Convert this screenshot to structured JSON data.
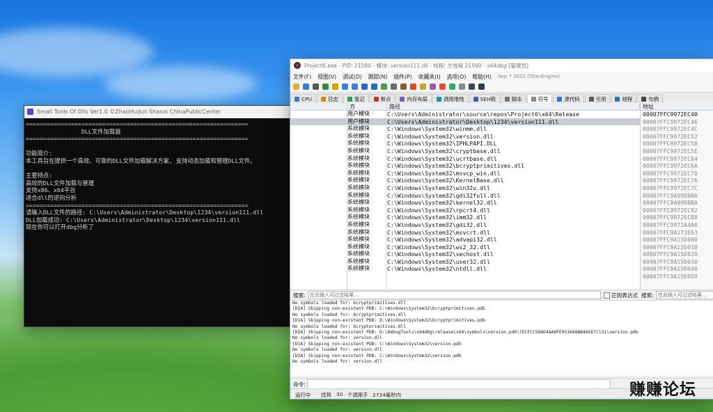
{
  "console": {
    "title": "Small Tools Of Dlls Ver1.0 ©ZhaoHuiJun Shanxi ChinaPublicCenter",
    "lines": [
      "================================================================",
      "                DLL文件加载器",
      "================================================================",
      "",
      "功能简介:",
      "本工具旨在提供一个高效、可靠的DLL文件加载解决方案, 支持动态加载和管理DLL文件。",
      "",
      "主要特点:",
      "高效的DLL文件加载与管理",
      "支持x86、x64平台",
      "适合dll的逆向分析",
      "================================================================",
      "请输入DLL文件的路径: C:\\Users\\Administrator\\Desktop\\1234\\version111.dll",
      "DLL加载成功: C:\\Users\\Administrator\\Desktop\\1234\\version111.dll",
      "现在你可以打开dbg分析了"
    ]
  },
  "dbg": {
    "title": "Project6.exe - PID: 21580 - 模块: version111.dll - 线程: 主线程 21560 - x64dbg [管理员]",
    "menu": [
      "文件(F)",
      "视图(V)",
      "调试(D)",
      "跟踪(N)",
      "插件(P)",
      "收藏夹(I)",
      "选项(O)",
      "帮助(H)"
    ],
    "menu_date": "Sep 7 2022 (TitanEngine)",
    "tabs": [
      "CPU",
      "日志",
      "笔记",
      "断点",
      "内存布局",
      "调用堆栈",
      "SEH链",
      "脚本",
      "符号",
      "源代码",
      "引用",
      "线程",
      "句柄"
    ],
    "active_tab": "符号",
    "headers": {
      "type": "方",
      "path": "路径",
      "addr": "地址"
    },
    "modules": [
      {
        "type": "用户模块",
        "path": "C:\\Users\\Administrator\\source\\repos\\Project6\\x64\\Release"
      },
      {
        "type": "用户模块",
        "path": "C:\\Users\\Administrator\\Desktop\\1234\\version111.dll"
      },
      {
        "type": "系统模块",
        "path": "C:\\Windows\\System32\\winmm.dll"
      },
      {
        "type": "系统模块",
        "path": "C:\\Windows\\System32\\version.dll"
      },
      {
        "type": "系统模块",
        "path": "C:\\Windows\\System32\\IPHLPAPI.DLL"
      },
      {
        "type": "系统模块",
        "path": "C:\\Windows\\System32\\cryptbase.dll"
      },
      {
        "type": "系统模块",
        "path": "C:\\Windows\\System32\\ucrtbase.dll"
      },
      {
        "type": "系统模块",
        "path": "C:\\Windows\\System32\\bcryptprimitives.dll"
      },
      {
        "type": "系统模块",
        "path": "C:\\Windows\\System32\\msvcp_win.dll"
      },
      {
        "type": "系统模块",
        "path": "C:\\Windows\\System32\\KernelBase.dll"
      },
      {
        "type": "系统模块",
        "path": "C:\\Windows\\System32\\win32u.dll"
      },
      {
        "type": "系统模块",
        "path": "C:\\Windows\\System32\\gdi32full.dll"
      },
      {
        "type": "系统模块",
        "path": "C:\\Windows\\System32\\kernel32.dll"
      },
      {
        "type": "系统模块",
        "path": "C:\\Windows\\System32\\rpcrt4.dll"
      },
      {
        "type": "系统模块",
        "path": "C:\\Windows\\System32\\imm32.dll"
      },
      {
        "type": "系统模块",
        "path": "C:\\Windows\\System32\\gdi32.dll"
      },
      {
        "type": "系统模块",
        "path": "C:\\Windows\\System32\\msvcrt.dll"
      },
      {
        "type": "系统模块",
        "path": "C:\\Windows\\System32\\advapi32.dll"
      },
      {
        "type": "系统模块",
        "path": "C:\\Windows\\System32\\ws2_32.dll"
      },
      {
        "type": "系统模块",
        "path": "C:\\Windows\\System32\\sechost.dll"
      },
      {
        "type": "系统模块",
        "path": "C:\\Windows\\System32\\user32.dll"
      },
      {
        "type": "系统模块",
        "path": "C:\\Windows\\System32\\ntdll.dll"
      }
    ],
    "addresses": [
      "00007FFC9972EC40",
      "00007FFC9972EC46",
      "00007FFC9972EC4C",
      "00007FFC9972EC52",
      "00007FFC9972EC58",
      "00007FFC9972EC5E",
      "00007FFC9972EC64",
      "00007FFC9972EC6A",
      "00007FFC9972EC70",
      "00007FFC9972EC76",
      "00007FFC9972EC7C",
      "00007FFC9A99D8A0",
      "00007FFC9A99D8BA",
      "00007FFC9972EC82",
      "00007FFC9972EC88",
      "00007FFC9972A4A0",
      "00007FFC9A173E63",
      "00007FFC9A15D000",
      "00007FFC9A15D010",
      "00007FFC9A15D020",
      "00007FFC9A15D030",
      "00007FFC9A15D040",
      "00007FFC9A15D050"
    ],
    "search": {
      "label": "搜索:",
      "placeholder": "在此输入可过滤结果...",
      "regex_label": "正则表达式",
      "label2": "搜索:",
      "placeholder2": "在此输入可过滤结果..."
    },
    "log": [
      "No symbols loaded for: bcryptprimitives.dll",
      "[DIA] Skipping non-existent PDB: C:\\Windows\\System32\\bcryptprimitives.pdb",
      "No symbols loaded for: bcryptprimitives.dll",
      "[DIA] Skipping non-existent PDB: D:\\Windows\\System32\\bcryptprimitives.pdb",
      "No symbols loaded for: bcryptprimitives.dll",
      "[DIA] Skipping non-existent PDB: D:\\DebugTools\\x64dbg\\release\\x64\\symbols\\version.pdb\\7ECFCC586D4AA8FE95166ABB4A567C131\\version.pdb",
      "No symbols loaded for: version.dll",
      "[DIA] Skipping non-existent PDB: C:\\Windows\\System32\\version.pdb",
      "No symbols loaded for: version.dll",
      "[DIA] Skipping non-existent PDB: C:\\Windows\\System32\\version.pdb",
      "No symbols loaded for: version.dll"
    ],
    "command_label": "命令:",
    "status": {
      "state": "运行中",
      "found_label": "找到",
      "found_count": "30",
      "found_suffix": "个调用于",
      "time": "2734毫秒内"
    }
  },
  "watermark": "赚赚论坛"
}
